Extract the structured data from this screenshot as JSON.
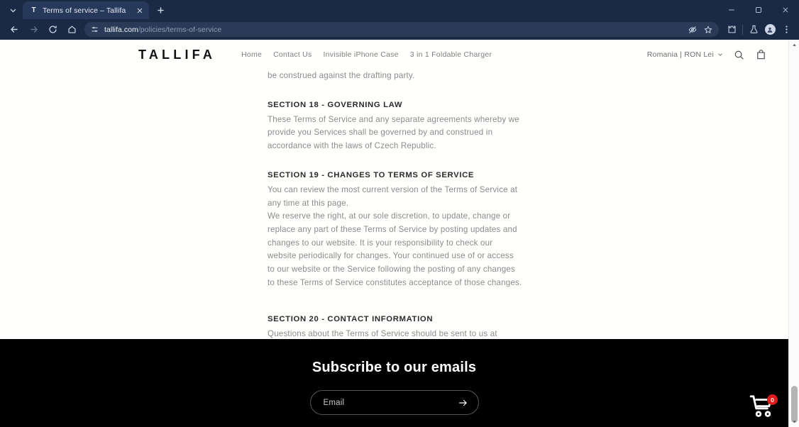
{
  "browser": {
    "tab": {
      "title": "Terms of service – Tallifa",
      "favicon_letter": "T",
      "favicon_name": "tallifa-favicon",
      "close_name": "close-icon"
    },
    "new_tab_label": "+",
    "window_controls": {
      "minimize": "minimize-icon",
      "maximize": "maximize-icon",
      "close": "close-icon"
    },
    "toolbar": {
      "back": "back-icon",
      "forward": "forward-icon",
      "reload": "reload-icon",
      "home": "home-icon",
      "site_settings": "tune-icon",
      "url_domain": "tallifa.com",
      "url_path": "/policies/terms-of-service",
      "tracking_protection": "eye-slash-icon",
      "bookmark": "star-icon",
      "extensions": "extensions-icon",
      "lab": "flask-icon",
      "profile": "profile-avatar-icon",
      "menu": "three-dot-menu-icon"
    }
  },
  "site": {
    "brand": "TALLIFA",
    "nav": [
      {
        "label": "Home"
      },
      {
        "label": "Contact Us"
      },
      {
        "label": "Invisible iPhone Case"
      },
      {
        "label": "3 in 1 Foldable Charger"
      }
    ],
    "locale": "Romania | RON Lei",
    "search_icon": "search-icon",
    "cart_icon": "shopping-bag-icon"
  },
  "policy": {
    "intro_tail": "be construed against the drafting party.",
    "sections": [
      {
        "heading": "SECTION 18 - GOVERNING LAW",
        "body": "These Terms of Service and any separate agreements whereby we provide you Services shall be governed by and construed in accordance with the laws of Czech Republic."
      },
      {
        "heading": "SECTION 19 - CHANGES TO TERMS OF SERVICE",
        "body": "You can review the most current version of the Terms of Service at any time at this page.",
        "body2": "We reserve the right, at our sole discretion, to update, change or replace any part of these Terms of Service by posting updates and changes to our website. It is your responsibility to check our website periodically for changes. Your continued use of or access to our website or the Service following the posting of any changes to these Terms of Service constitutes acceptance of those changes."
      },
      {
        "heading": "SECTION 20 - CONTACT INFORMATION",
        "body": "Questions about the Terms of Service should be sent to us at tallifa.official@gmail.com."
      }
    ]
  },
  "footer": {
    "heading": "Subscribe to our emails",
    "email_placeholder": "Email",
    "email_value": "",
    "submit_icon": "arrow-right-icon"
  },
  "cart_widget": {
    "icon": "shopping-cart-icon",
    "count": "0"
  },
  "colors": {
    "chrome": "#1b2a44",
    "tab_active": "#27395a",
    "footer_bg": "#000000",
    "badge_red": "#e01b1b",
    "body_text": "#8b8b8b",
    "heading_text": "#2b2b2b"
  }
}
